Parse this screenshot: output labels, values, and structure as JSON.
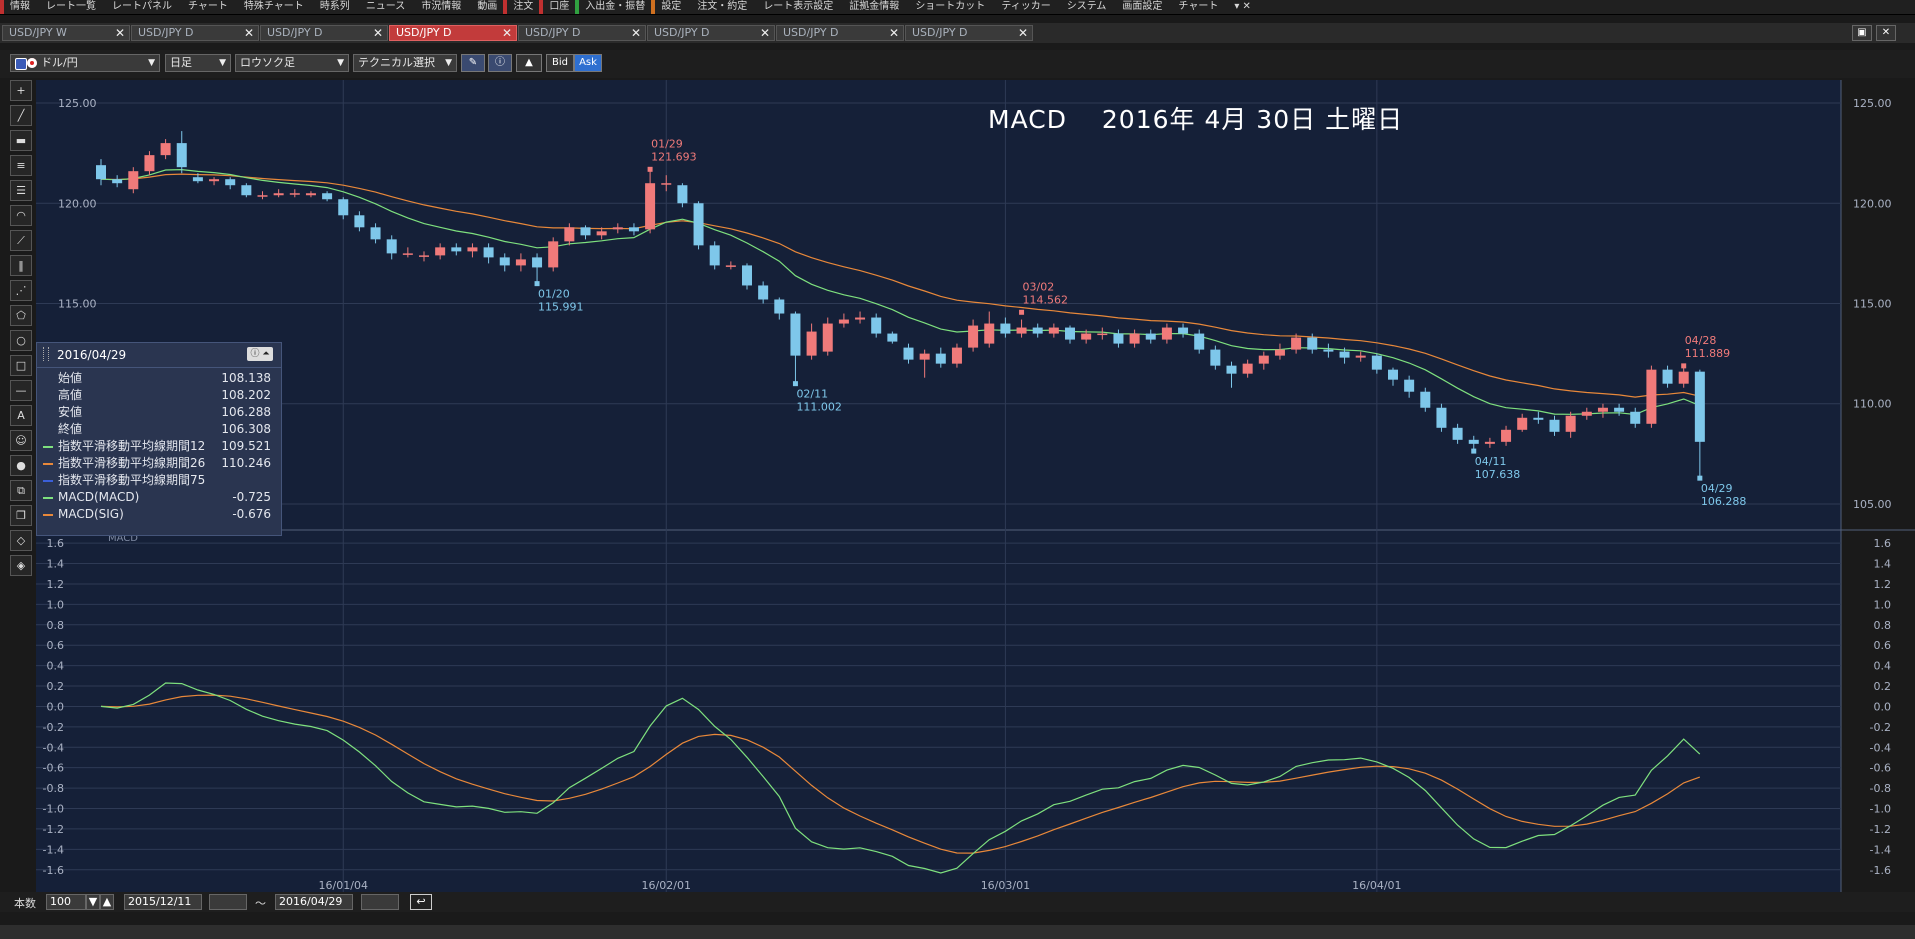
{
  "menu": [
    {
      "label": "情報",
      "hl": "hl1"
    },
    {
      "label": "レート一覧",
      "hl": ""
    },
    {
      "label": "レートパネル",
      "hl": ""
    },
    {
      "label": "チャート",
      "hl": ""
    },
    {
      "label": "特殊チャート",
      "hl": ""
    },
    {
      "label": "時系列",
      "hl": ""
    },
    {
      "label": "ニュース",
      "hl": ""
    },
    {
      "label": "市況情報",
      "hl": ""
    },
    {
      "label": "動画",
      "hl": ""
    },
    {
      "label": "注文",
      "hl": "hl1"
    },
    {
      "label": "口座",
      "hl": "hl1"
    },
    {
      "label": "入出金・振替",
      "hl": "hl2"
    },
    {
      "label": "設定",
      "hl": "hl3"
    },
    {
      "label": "注文・約定",
      "hl": ""
    },
    {
      "label": "レート表示設定",
      "hl": ""
    },
    {
      "label": "証拠金情報",
      "hl": ""
    },
    {
      "label": "ショートカット",
      "hl": ""
    },
    {
      "label": "ティッカー",
      "hl": ""
    },
    {
      "label": "システム",
      "hl": ""
    },
    {
      "label": "画面設定",
      "hl": ""
    },
    {
      "label": "チャート",
      "hl": ""
    }
  ],
  "tabs": [
    "USD/JPY W",
    "USD/JPY D",
    "USD/JPY D",
    "USD/JPY D",
    "USD/JPY D",
    "USD/JPY D",
    "USD/JPY D",
    "USD/JPY D"
  ],
  "active_tab": 3,
  "toolbar": {
    "pair": "ドル/円",
    "period": "日足",
    "style": "ロウソク足",
    "technical": "テクニカル選択",
    "bid": "Bid",
    "ask": "Ask"
  },
  "chart_title": "MACD　 2016年 4月 30日 土曜日",
  "info_panel": {
    "date": "2016/04/29",
    "rows": [
      {
        "label": "始値",
        "value": "108.138",
        "color": ""
      },
      {
        "label": "高値",
        "value": "108.202",
        "color": ""
      },
      {
        "label": "安値",
        "value": "106.288",
        "color": ""
      },
      {
        "label": "終値",
        "value": "106.308",
        "color": ""
      },
      {
        "label": "指数平滑移動平均線期間12",
        "value": "109.521",
        "color": "#7ee07e"
      },
      {
        "label": "指数平滑移動平均線期間26",
        "value": "110.246",
        "color": "#e8883a"
      },
      {
        "label": "指数平滑移動平均線期間75",
        "value": "",
        "color": "#3b5fd8"
      },
      {
        "label": "MACD(MACD)",
        "value": "-0.725",
        "color": "#7ee07e"
      },
      {
        "label": "MACD(SIG)",
        "value": "-0.676",
        "color": "#e8883a"
      }
    ]
  },
  "bottom": {
    "count_label": "本数",
    "count": "100",
    "from": "2015/12/11",
    "tilde": "〜",
    "to": "2016/04/29"
  },
  "colors": {
    "up": "#f07a7a",
    "down": "#7ec7ea",
    "ema12": "#7ee07e",
    "ema26": "#e8883a",
    "bg": "#152038",
    "grid": "#2e3a55"
  },
  "chart_data": {
    "type": "candlestick",
    "dates": [
      "12/11",
      "12/14",
      "12/15",
      "12/16",
      "12/17",
      "12/18",
      "12/21",
      "12/22",
      "12/23",
      "12/24",
      "12/25",
      "12/28",
      "12/29",
      "12/30",
      "12/31",
      "01/04",
      "01/05",
      "01/06",
      "01/07",
      "01/08",
      "01/11",
      "01/12",
      "01/13",
      "01/14",
      "01/15",
      "01/18",
      "01/19",
      "01/20",
      "01/21",
      "01/22",
      "01/25",
      "01/26",
      "01/27",
      "01/28",
      "01/29",
      "02/01",
      "02/02",
      "02/03",
      "02/04",
      "02/05",
      "02/08",
      "02/09",
      "02/10",
      "02/11",
      "02/12",
      "02/15",
      "02/16",
      "02/17",
      "02/18",
      "02/19",
      "02/22",
      "02/23",
      "02/24",
      "02/25",
      "02/26",
      "02/29",
      "03/01",
      "03/02",
      "03/03",
      "03/04",
      "03/07",
      "03/08",
      "03/09",
      "03/10",
      "03/11",
      "03/14",
      "03/15",
      "03/16",
      "03/17",
      "03/18",
      "03/21",
      "03/22",
      "03/23",
      "03/24",
      "03/25",
      "03/28",
      "03/29",
      "03/30",
      "03/31",
      "04/01",
      "04/04",
      "04/05",
      "04/06",
      "04/07",
      "04/08",
      "04/11",
      "04/12",
      "04/13",
      "04/14",
      "04/15",
      "04/18",
      "04/19",
      "04/20",
      "04/21",
      "04/22",
      "04/25",
      "04/26",
      "04/27",
      "04/28",
      "04/29"
    ],
    "open": [
      121.9,
      121.2,
      120.7,
      121.6,
      122.4,
      123.0,
      121.3,
      121.1,
      121.2,
      120.9,
      120.4,
      120.4,
      120.5,
      120.4,
      120.5,
      120.2,
      119.4,
      118.8,
      118.2,
      117.5,
      117.4,
      117.4,
      117.8,
      117.6,
      117.8,
      117.3,
      116.9,
      117.3,
      116.8,
      118.1,
      118.8,
      118.4,
      118.7,
      118.8,
      118.7,
      121.0,
      120.9,
      120.0,
      117.9,
      116.9,
      116.9,
      115.9,
      115.2,
      114.5,
      112.4,
      112.6,
      114.0,
      114.2,
      114.3,
      113.5,
      112.8,
      112.2,
      112.5,
      112.0,
      112.8,
      113.0,
      114.0,
      113.5,
      113.8,
      113.5,
      113.8,
      113.2,
      113.5,
      113.5,
      113.0,
      113.5,
      113.2,
      113.8,
      113.5,
      112.7,
      111.9,
      111.5,
      112.0,
      112.4,
      112.7,
      113.3,
      112.7,
      112.6,
      112.3,
      112.4,
      111.7,
      111.2,
      110.6,
      109.8,
      108.8,
      108.2,
      108.0,
      108.1,
      108.7,
      109.3,
      109.2,
      108.6,
      109.4,
      109.6,
      109.8,
      109.6,
      109.0,
      111.7,
      111.0,
      111.6
    ],
    "close": [
      121.2,
      121.0,
      121.6,
      122.4,
      123.0,
      121.8,
      121.1,
      121.2,
      120.9,
      120.4,
      120.4,
      120.5,
      120.5,
      120.5,
      120.2,
      119.4,
      118.8,
      118.2,
      117.5,
      117.5,
      117.4,
      117.8,
      117.6,
      117.8,
      117.3,
      116.9,
      117.2,
      116.8,
      118.1,
      118.8,
      118.4,
      118.6,
      118.8,
      118.6,
      121.0,
      121.0,
      120.0,
      117.9,
      116.9,
      116.9,
      115.9,
      115.2,
      114.5,
      112.4,
      113.6,
      114.0,
      114.2,
      114.3,
      113.5,
      113.1,
      112.2,
      112.5,
      112.0,
      112.8,
      113.9,
      114.0,
      113.5,
      113.8,
      113.5,
      113.8,
      113.2,
      113.5,
      113.5,
      113.0,
      113.5,
      113.2,
      113.8,
      113.5,
      112.7,
      111.9,
      111.5,
      112.0,
      112.4,
      112.7,
      113.3,
      112.7,
      112.6,
      112.3,
      112.4,
      111.7,
      111.2,
      110.6,
      109.8,
      108.8,
      108.2,
      108.0,
      108.1,
      108.7,
      109.3,
      109.2,
      108.6,
      109.4,
      109.6,
      109.8,
      109.6,
      109.0,
      111.7,
      111.0,
      111.6,
      108.1
    ],
    "high": [
      122.2,
      121.4,
      121.8,
      122.6,
      123.2,
      123.6,
      121.5,
      121.3,
      121.3,
      121.0,
      120.6,
      120.7,
      120.7,
      120.6,
      120.6,
      120.3,
      119.6,
      119.0,
      118.4,
      117.8,
      117.6,
      118.0,
      118.0,
      118.0,
      118.0,
      117.5,
      117.5,
      117.5,
      118.3,
      119.0,
      118.9,
      118.8,
      119.0,
      119.0,
      121.7,
      121.4,
      121.0,
      120.1,
      118.1,
      117.1,
      117.0,
      116.1,
      115.3,
      114.6,
      114.0,
      114.3,
      114.5,
      114.6,
      114.5,
      113.6,
      113.0,
      112.7,
      112.8,
      113.0,
      114.2,
      114.6,
      114.3,
      114.2,
      114.0,
      114.0,
      113.9,
      113.7,
      113.8,
      113.7,
      113.7,
      113.7,
      114.0,
      114.0,
      113.7,
      112.9,
      112.1,
      112.2,
      112.6,
      113.0,
      113.5,
      113.5,
      113.0,
      112.8,
      112.6,
      112.5,
      111.8,
      111.4,
      110.8,
      110.0,
      109.0,
      108.4,
      108.3,
      108.9,
      109.5,
      109.6,
      109.4,
      109.6,
      109.8,
      110.0,
      110.0,
      109.8,
      111.9,
      111.9,
      111.9,
      111.7
    ],
    "low": [
      120.9,
      120.8,
      120.5,
      121.4,
      122.2,
      121.5,
      121.0,
      120.9,
      120.7,
      120.3,
      120.2,
      120.3,
      120.3,
      120.3,
      120.1,
      119.2,
      118.6,
      118.0,
      117.2,
      117.3,
      117.1,
      117.2,
      117.4,
      117.3,
      117.0,
      116.6,
      116.6,
      115.99,
      116.6,
      117.9,
      118.2,
      118.2,
      118.5,
      118.4,
      118.5,
      120.6,
      119.8,
      117.7,
      116.7,
      116.7,
      115.7,
      115.0,
      114.2,
      111.0,
      112.2,
      112.4,
      113.8,
      114.0,
      113.3,
      113.0,
      112.0,
      111.3,
      111.8,
      111.8,
      112.6,
      112.8,
      113.3,
      113.3,
      113.3,
      113.3,
      113.0,
      113.0,
      113.2,
      112.8,
      112.8,
      113.0,
      113.0,
      113.3,
      112.5,
      111.7,
      110.8,
      111.3,
      111.7,
      112.2,
      112.5,
      112.5,
      112.3,
      112.0,
      112.1,
      111.5,
      110.9,
      110.3,
      109.6,
      108.6,
      108.0,
      107.638,
      107.8,
      107.9,
      108.6,
      109.0,
      108.4,
      108.3,
      109.2,
      109.3,
      109.4,
      108.8,
      108.8,
      110.8,
      110.8,
      106.288
    ],
    "annotations": [
      {
        "date": "01/20",
        "value": "115.991",
        "type": "low"
      },
      {
        "date": "01/29",
        "value": "121.693",
        "type": "high"
      },
      {
        "date": "02/11",
        "value": "111.002",
        "type": "low"
      },
      {
        "date": "03/02",
        "value": "114.562",
        "type": "high"
      },
      {
        "date": "04/11",
        "value": "107.638",
        "type": "low"
      },
      {
        "date": "04/28",
        "value": "111.889",
        "type": "high"
      },
      {
        "date": "04/29",
        "value": "106.288",
        "type": "low"
      }
    ],
    "price_axis": {
      "min": 104.6,
      "max": 125.4,
      "ticks": [
        "125.00",
        "120.00",
        "115.00",
        "110.00",
        "105.00"
      ]
    },
    "macd_axis": {
      "min": -1.72,
      "max": 1.66,
      "ticks": [
        "1.6",
        "1.4",
        "1.2",
        "1.0",
        "0.8",
        "0.6",
        "0.4",
        "0.2",
        "0.0",
        "-0.2",
        "-0.4",
        "-0.6",
        "-0.8",
        "-1.0",
        "-1.2",
        "-1.4",
        "-1.6"
      ]
    },
    "macd_label": "MACD",
    "date_labels": [
      {
        "date": "16/01/04",
        "index": 15
      },
      {
        "date": "16/02/01",
        "index": 35
      },
      {
        "date": "16/03/01",
        "index": 56
      },
      {
        "date": "16/04/01",
        "index": 79
      }
    ],
    "macd_series": {
      "macd": [],
      "signal": []
    }
  }
}
